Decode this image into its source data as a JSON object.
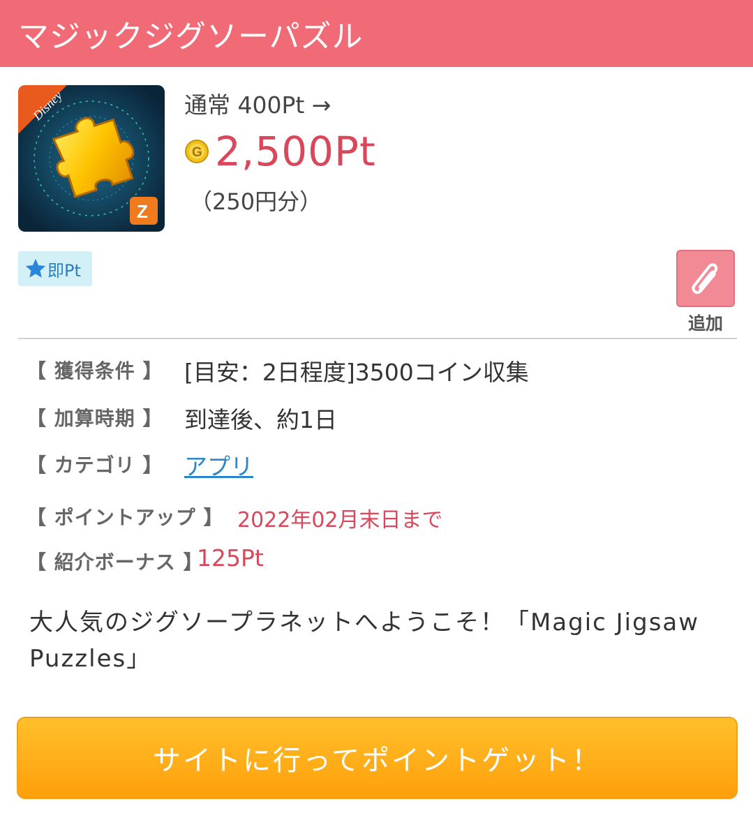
{
  "header": {
    "title": "マジックジグソーパズル"
  },
  "app": {
    "icon_name": "magic-jigsaw-app-icon"
  },
  "price": {
    "normal": "通常 400Pt →",
    "coin_icon": "g-coin-icon",
    "current": "2,500Pt",
    "yen": "（250円分）"
  },
  "badge": {
    "icon": "star-icon",
    "label": "即Pt"
  },
  "add": {
    "icon": "paperclip-icon",
    "label": "追加"
  },
  "info": {
    "condition_label": "【 獲得条件 】",
    "condition_value": "[目安：2日程度]3500コイン収集",
    "timing_label": "【 加算時期 】",
    "timing_value": "到達後、約1日",
    "category_label": "【 カテゴリ 】",
    "category_value": "アプリ",
    "pointup_label": "【 ポイントアップ 】",
    "pointup_value": "2022年02月末日まで",
    "bonus_label": "【 紹介ボーナス 】",
    "bonus_value": "125Pt"
  },
  "description": "大人気のジグソープラネットへようこそ！「Magic Jigsaw Puzzles」",
  "cta": {
    "label": "サイトに行ってポイントゲット！"
  },
  "colors": {
    "header": "#f06b75",
    "accent_red": "#d9475a",
    "link": "#2a86c9",
    "cta": "#ffb01a"
  }
}
